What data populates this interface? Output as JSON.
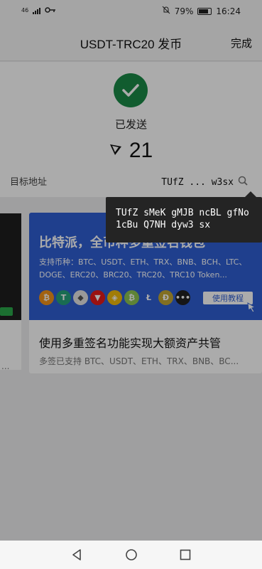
{
  "status_bar": {
    "signal_text": "46",
    "key_icon": "key-icon",
    "battery_percent": "79%",
    "time": "16:24"
  },
  "header": {
    "title": "USDT-TRC20 发币",
    "done_label": "完成"
  },
  "result": {
    "status_label": "已发送",
    "amount": "21",
    "address_label": "目标地址",
    "address_short": "TUfZ ... w3sx",
    "success_color": "#1a8a46"
  },
  "tooltip": {
    "line1": "TUfZ sMeK gMJB ncBL gfNo",
    "line2": "1cBu Q7NH dyw3 sx"
  },
  "banner": {
    "title": "比特派，全币种多重签名钱包",
    "sub_line1": "支持币种：BTC、USDT、ETH、TRX、BNB、BCH、LTC、",
    "sub_line2": "DOGE、ERC20、BRC20、TRC20、TRC10 Token...",
    "tutorial_label": "使用教程",
    "coins": [
      "btc",
      "usdt",
      "eth",
      "trx",
      "bnb",
      "bch",
      "ltc",
      "doge",
      "more"
    ],
    "bg_color": "#2f5fd3"
  },
  "card": {
    "title": "使用多重签名功能实现大额资产共管",
    "subtitle": "多签已支持 BTC、USDT、ETH、TRX、BNB、BC..."
  },
  "left_card": {
    "ellipsis": "..."
  },
  "navbar": {
    "icons": [
      "back-icon",
      "home-icon",
      "recents-icon"
    ]
  }
}
